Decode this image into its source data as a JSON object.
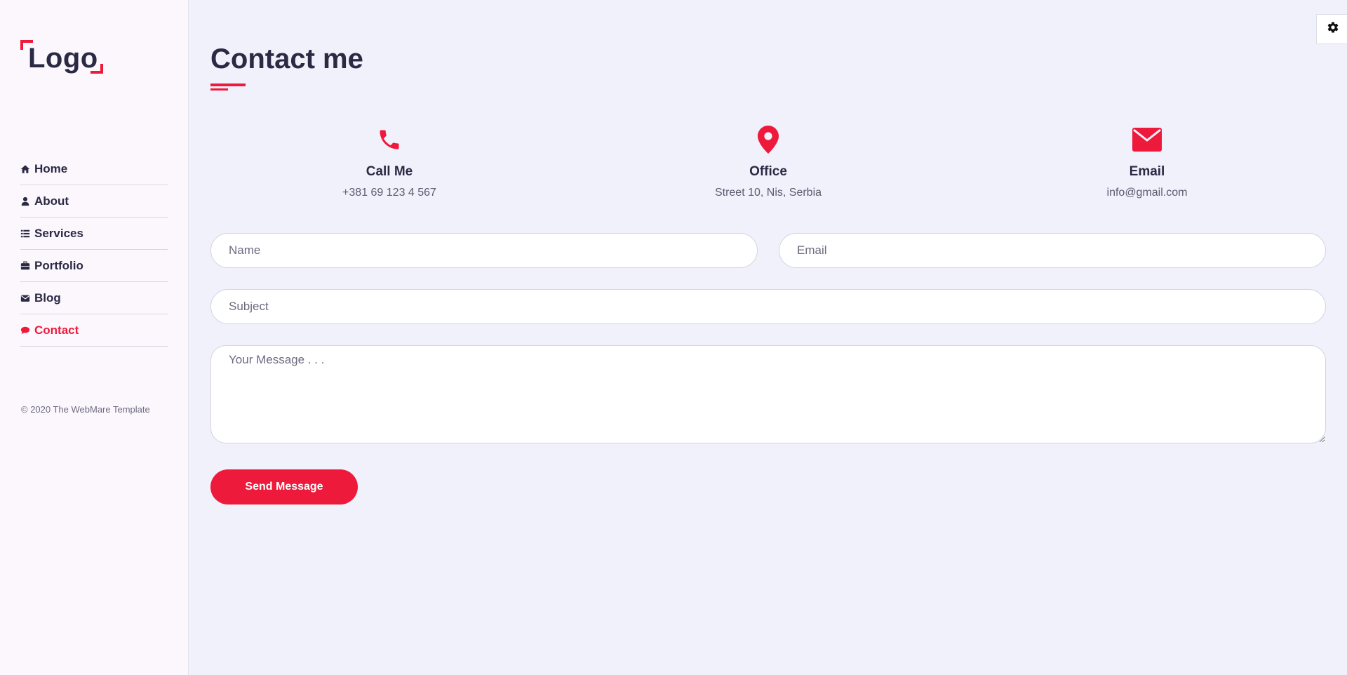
{
  "sidebar": {
    "logo": "Logo",
    "items": [
      {
        "label": "Home",
        "icon": "home-icon"
      },
      {
        "label": "About",
        "icon": "user-icon"
      },
      {
        "label": "Services",
        "icon": "list-icon"
      },
      {
        "label": "Portfolio",
        "icon": "briefcase-icon"
      },
      {
        "label": "Blog",
        "icon": "envelope-icon"
      },
      {
        "label": "Contact",
        "icon": "comments-icon",
        "active": true
      }
    ],
    "copyright": "© 2020 The WebMare Template"
  },
  "main": {
    "title": "Contact me",
    "info": [
      {
        "title": "Call Me",
        "value": "+381 69 123 4 567",
        "icon": "phone-icon"
      },
      {
        "title": "Office",
        "value": "Street 10, Nis, Serbia",
        "icon": "map-marker-icon"
      },
      {
        "title": "Email",
        "value": "info@gmail.com",
        "icon": "envelope-icon"
      }
    ],
    "form": {
      "name_placeholder": "Name",
      "email_placeholder": "Email",
      "subject_placeholder": "Subject",
      "message_placeholder": "Your Message . . .",
      "submit_label": "Send Message"
    }
  },
  "settings": {
    "icon": "gear-icon"
  },
  "colors": {
    "accent": "#ee1a3b",
    "text": "#2b2a45",
    "background": "#f0f1fa",
    "sidebar": "#fcf7fd"
  }
}
